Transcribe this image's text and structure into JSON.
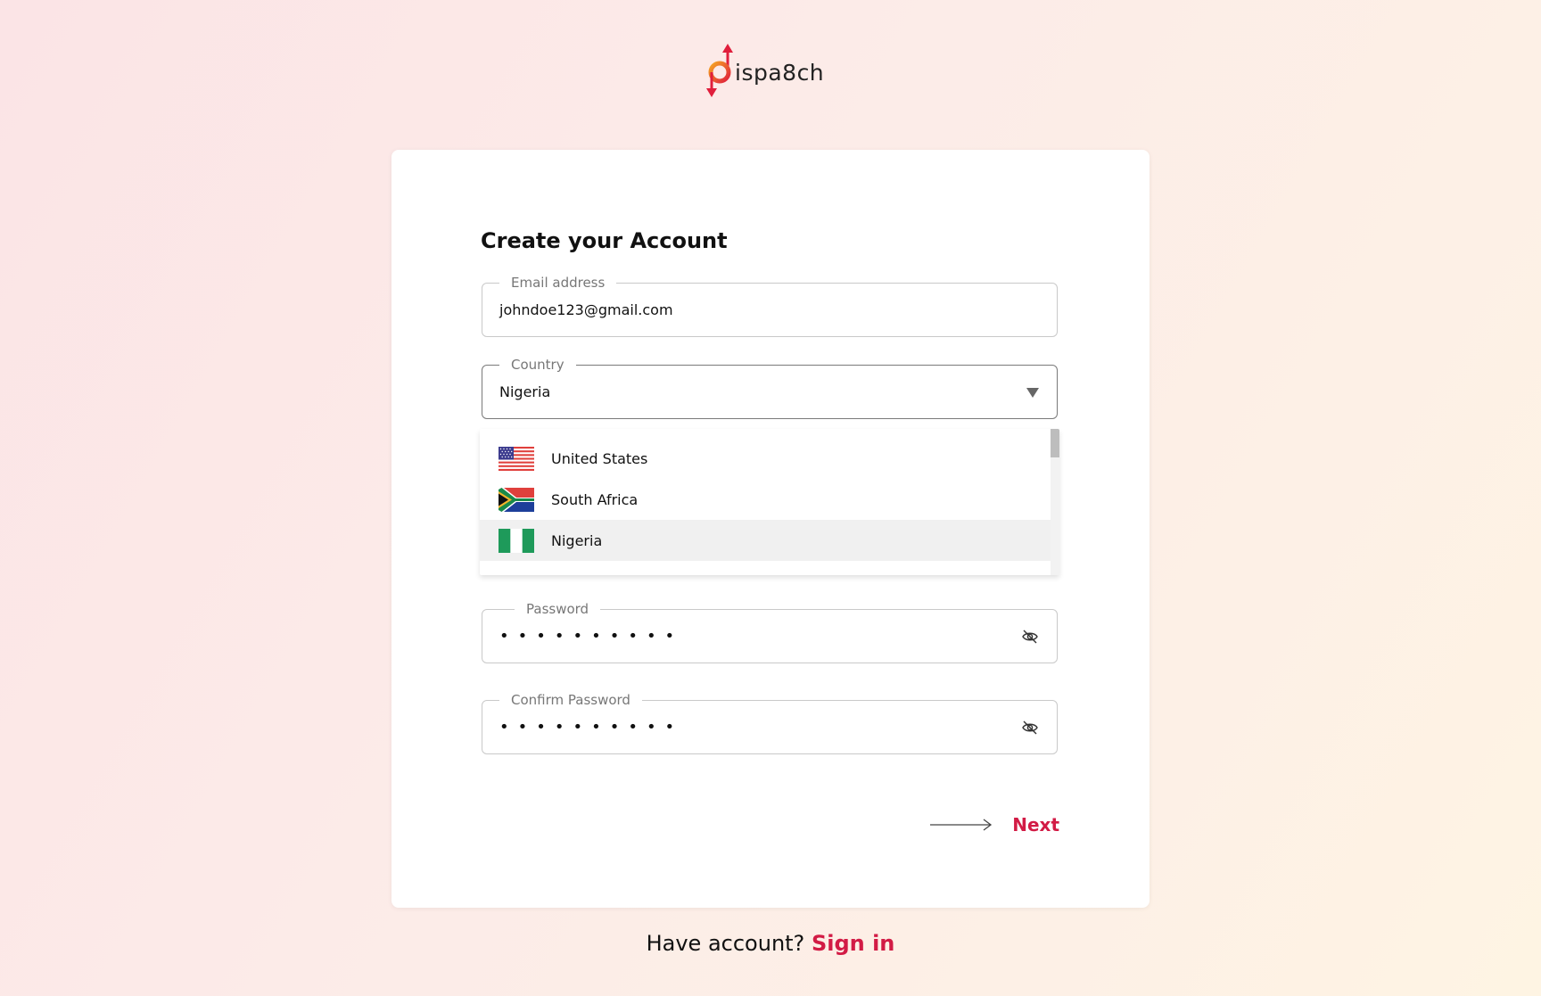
{
  "brand": {
    "name": "ispa8ch",
    "accent_color": "#d21b45",
    "logo_colors": [
      "#e01e3c",
      "#f5a623"
    ]
  },
  "form": {
    "title": "Create your Account",
    "email": {
      "label": "Email address",
      "value": "johndoe123@gmail.com"
    },
    "country": {
      "label": "Country",
      "value": "Nigeria",
      "options": [
        {
          "label": "United States",
          "flag": "us-flag-icon"
        },
        {
          "label": "South Africa",
          "flag": "za-flag-icon"
        },
        {
          "label": "Nigeria",
          "flag": "ng-flag-icon",
          "selected": true
        }
      ]
    },
    "password": {
      "label": "Password",
      "masked": "••••••••••"
    },
    "confirm_password": {
      "label": "Confirm Password",
      "masked": "••••••••••"
    },
    "next_label": "Next"
  },
  "footer": {
    "prompt": "Have account?",
    "signin_label": "Sign in"
  }
}
